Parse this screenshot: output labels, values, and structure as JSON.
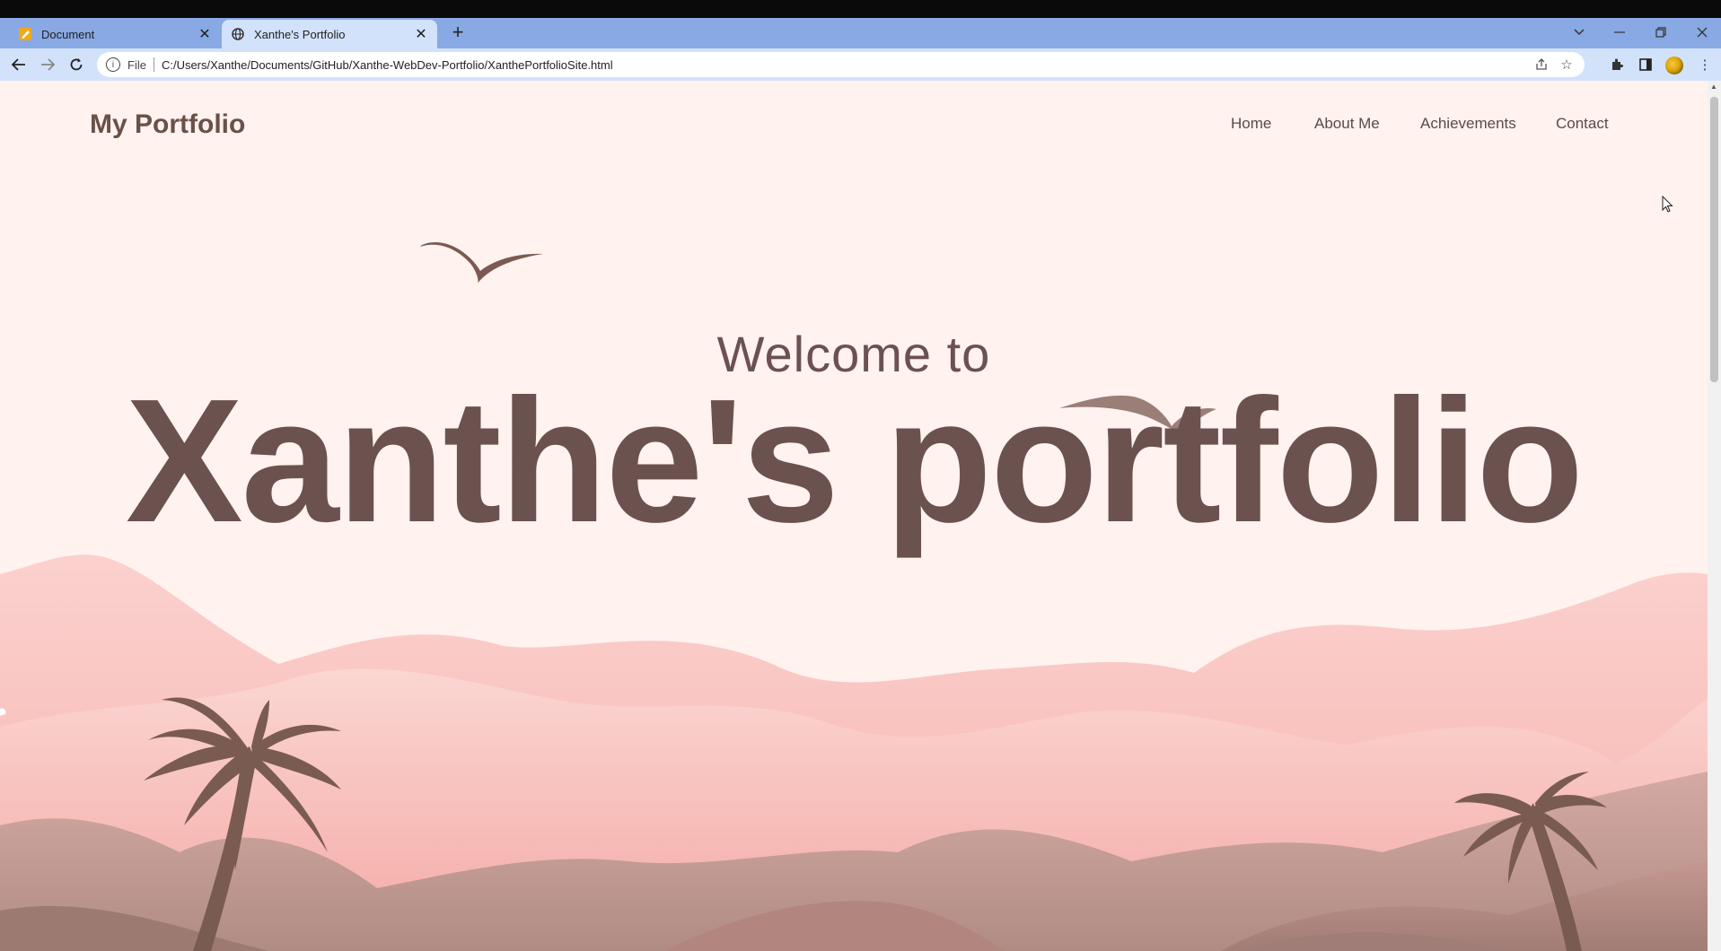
{
  "browser": {
    "tabs": [
      {
        "title": "Document",
        "active": false,
        "icon": "document-icon"
      },
      {
        "title": "Xanthe's Portfolio",
        "active": true,
        "icon": "globe-icon"
      }
    ],
    "address": {
      "scheme_label": "File",
      "url": "C:/Users/Xanthe/Documents/GitHub/Xanthe-WebDev-Portfolio/XanthePortfolioSite.html"
    },
    "toolbar_icons": [
      "back-icon",
      "forward-icon",
      "reload-icon",
      "info-icon",
      "share-icon",
      "bookmark-star-icon",
      "extensions-icon",
      "side-panel-icon",
      "profile-avatar",
      "menu-icon"
    ],
    "window_controls": [
      "tab-search-icon",
      "minimize-icon",
      "restore-icon",
      "close-icon"
    ]
  },
  "site": {
    "logo": "My Portfolio",
    "nav": {
      "home": "Home",
      "about": "About Me",
      "achievements": "Achievements",
      "contact": "Contact"
    },
    "hero": {
      "welcome": "Welcome to",
      "title": "Xanthe's portfolio"
    }
  },
  "colors": {
    "page_bg": "#fff2ef",
    "text_brown": "#6b524f",
    "tabbar": "#88a9e3",
    "toolbar": "#d3e2fb",
    "mountain_light": "#f7c0bc",
    "mountain_mid": "#f2aaa6",
    "hill_tan": "#c9a39b",
    "palm_brown": "#7a5b52"
  }
}
